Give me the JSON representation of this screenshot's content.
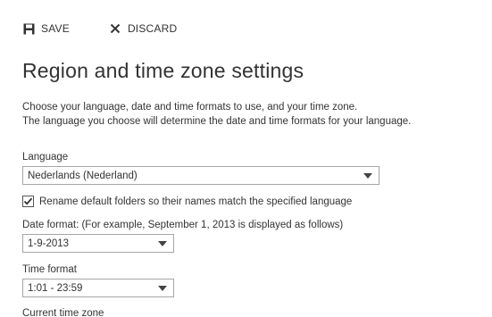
{
  "toolbar": {
    "save_label": "SAVE",
    "discard_label": "DISCARD"
  },
  "page": {
    "title": "Region and time zone settings",
    "intro_line1": "Choose your language, date and time formats to use, and your time zone.",
    "intro_line2": "The language you choose will determine the date and time formats for your language."
  },
  "language": {
    "label": "Language",
    "selected": "Nederlands (Nederland)"
  },
  "rename_folders": {
    "checked": true,
    "label": "Rename default folders so their names match the specified language"
  },
  "date_format": {
    "label": "Date format: (For example, September 1, 2013 is displayed as follows)",
    "selected": "1-9-2013"
  },
  "time_format": {
    "label": "Time format",
    "selected": "1:01 - 23:59"
  },
  "time_zone": {
    "label": "Current time zone"
  },
  "icons": {
    "save": "floppy-disk-icon",
    "discard": "close-x-icon",
    "dropdown": "chevron-down-icon",
    "check": "checkmark-icon"
  }
}
